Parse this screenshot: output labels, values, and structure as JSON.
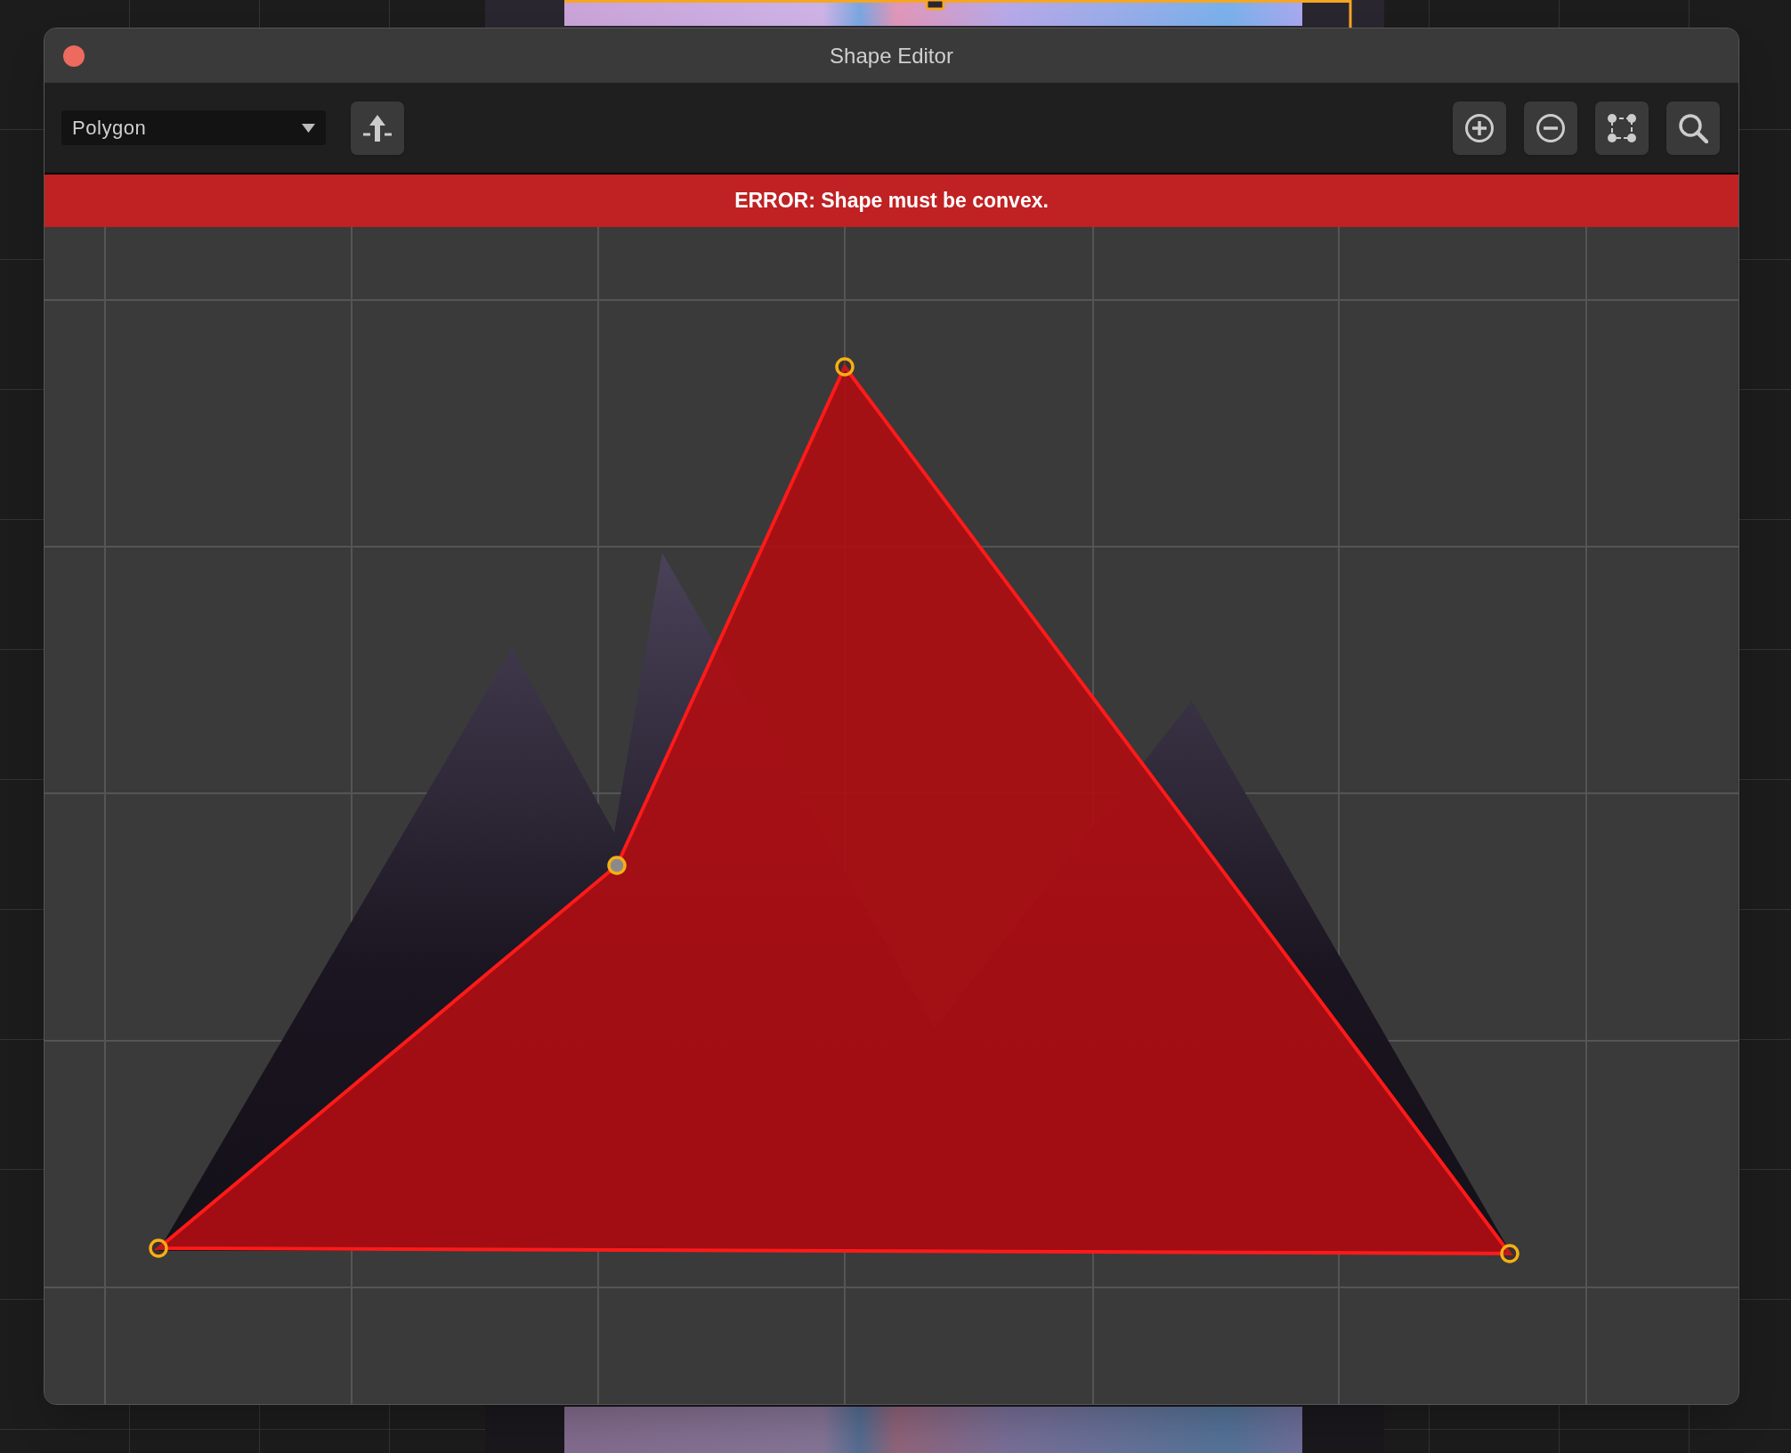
{
  "window": {
    "title": "Shape Editor"
  },
  "toolbar": {
    "shape_type": "Polygon"
  },
  "error_banner": {
    "message": "ERROR: Shape must be convex."
  },
  "vertices": [
    {
      "selected": false
    },
    {
      "selected": true
    },
    {
      "selected": false
    },
    {
      "selected": false
    }
  ]
}
